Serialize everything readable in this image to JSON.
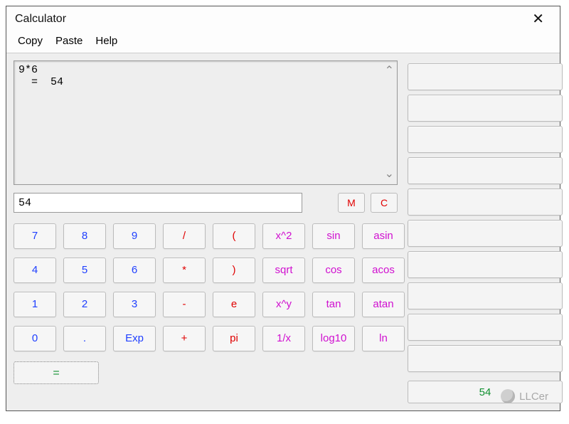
{
  "window": {
    "title": "Calculator"
  },
  "menu": {
    "copy": "Copy",
    "paste": "Paste",
    "help": "Help"
  },
  "history": {
    "text": "9*6\n  =  54"
  },
  "entry": {
    "value": "54"
  },
  "mc": {
    "m": "M",
    "c": "C"
  },
  "keys": {
    "r0": [
      "7",
      "8",
      "9",
      "/",
      "(",
      "x^2",
      "sin",
      "asin"
    ],
    "r1": [
      "4",
      "5",
      "6",
      "*",
      ")",
      "sqrt",
      "cos",
      "acos"
    ],
    "r2": [
      "1",
      "2",
      "3",
      "-",
      "e",
      "x^y",
      "tan",
      "atan"
    ],
    "r3": [
      "0",
      ".",
      "Exp",
      "+",
      "pi",
      "1/x",
      "log10",
      "ln"
    ]
  },
  "equals": {
    "label": "="
  },
  "result": {
    "value": "54"
  },
  "watermark": {
    "text": "LLCer"
  }
}
